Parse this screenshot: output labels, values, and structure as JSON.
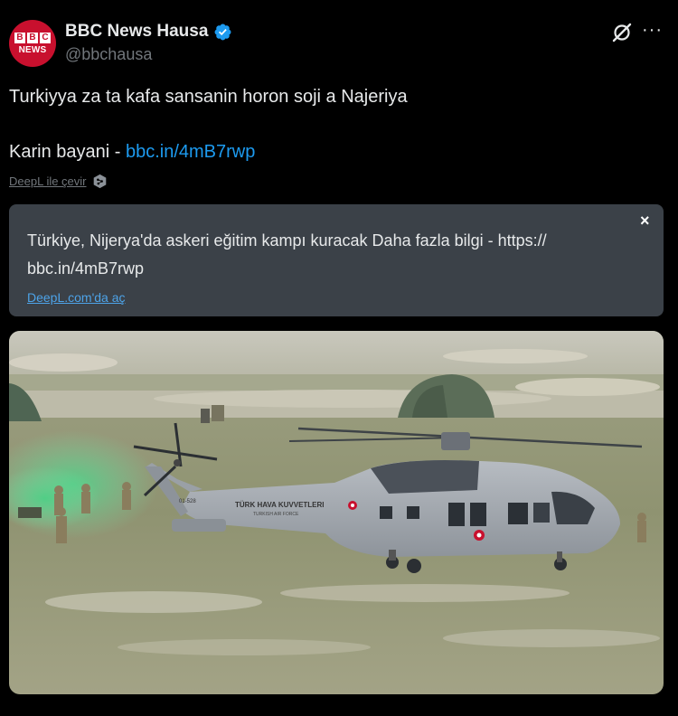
{
  "author": {
    "avatar_text": "BBC",
    "avatar_subtext": "NEWS",
    "name": "BBC News Hausa",
    "handle": "@bbchausa",
    "verified": true,
    "brand_color": "#c8102e",
    "verified_color": "#1d9bf0"
  },
  "header_icons": {
    "grok": "grok-icon",
    "more": "more-icon",
    "more_glyph": "···"
  },
  "tweet": {
    "line1": "Turkiyya za ta kafa sansanin horon soji a Najeriya",
    "line2_prefix": "Karin bayani - ",
    "link": "bbc.in/4mB7rwp"
  },
  "translate_link": "DeepL ile çevir",
  "translation": {
    "text": "Türkiye, Nijerya'da askeri eğitim kampı kuracak  Daha fazla bilgi -  https:// bbc.in/4mB7rwp",
    "close": "×",
    "open_link": "DeepL.com'da aç"
  },
  "photo": {
    "helicopter_text": "TÜRK HAVA KUVVETLERI",
    "helicopter_subtext": "TURKISH AIR FORCE",
    "tail_number": "01-528"
  }
}
